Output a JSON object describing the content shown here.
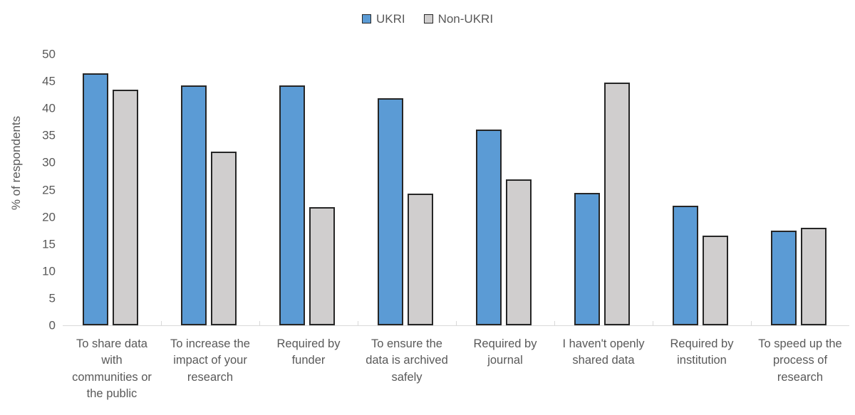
{
  "chart_data": {
    "type": "bar",
    "title": "",
    "subtitle": "",
    "xlabel": "",
    "ylabel": "% of respondents",
    "ylim": [
      0,
      50
    ],
    "ytick_step": 5,
    "yticks": [
      50,
      45,
      40,
      35,
      30,
      25,
      20,
      15,
      10,
      5,
      0
    ],
    "grid": false,
    "legend_position": "top-center",
    "categories": [
      "To share data with communities or the public",
      "To increase the impact of your research",
      "Required by funder",
      "To ensure the data is archived safely",
      "Required by journal",
      "I haven't openly shared data",
      "Required by institution",
      "To speed up the process of research"
    ],
    "category_lines": [
      [
        "To share data",
        "with",
        "communities or",
        "the public"
      ],
      [
        "To increase the",
        "impact of your",
        "research"
      ],
      [
        "Required by",
        "funder"
      ],
      [
        "To ensure the",
        "data is archived",
        "safely"
      ],
      [
        "Required by",
        "journal"
      ],
      [
        "I haven't openly",
        "shared data"
      ],
      [
        "Required by",
        "institution"
      ],
      [
        "To speed up the",
        "process of",
        "research"
      ]
    ],
    "series": [
      {
        "name": "UKRI",
        "color": "#5B9BD5",
        "values": [
          46.5,
          44.2,
          44.2,
          41.8,
          36.1,
          24.4,
          22.0,
          17.5
        ]
      },
      {
        "name": "Non-UKRI",
        "color": "#D0CECE",
        "values": [
          43.5,
          32.0,
          21.8,
          24.3,
          26.9,
          44.8,
          16.6,
          18.0
        ]
      }
    ]
  },
  "legend": {
    "entries": [
      {
        "label": "UKRI",
        "color": "#5B9BD5"
      },
      {
        "label": "Non-UKRI",
        "color": "#D0CECE"
      }
    ]
  },
  "axis": {
    "y_title": "% of respondents"
  },
  "colors": {
    "ukri": "#5B9BD5",
    "non_ukri": "#D0CECE",
    "bar_border": "#262626",
    "text": "#595959",
    "axis_line": "#D9D9D9"
  }
}
